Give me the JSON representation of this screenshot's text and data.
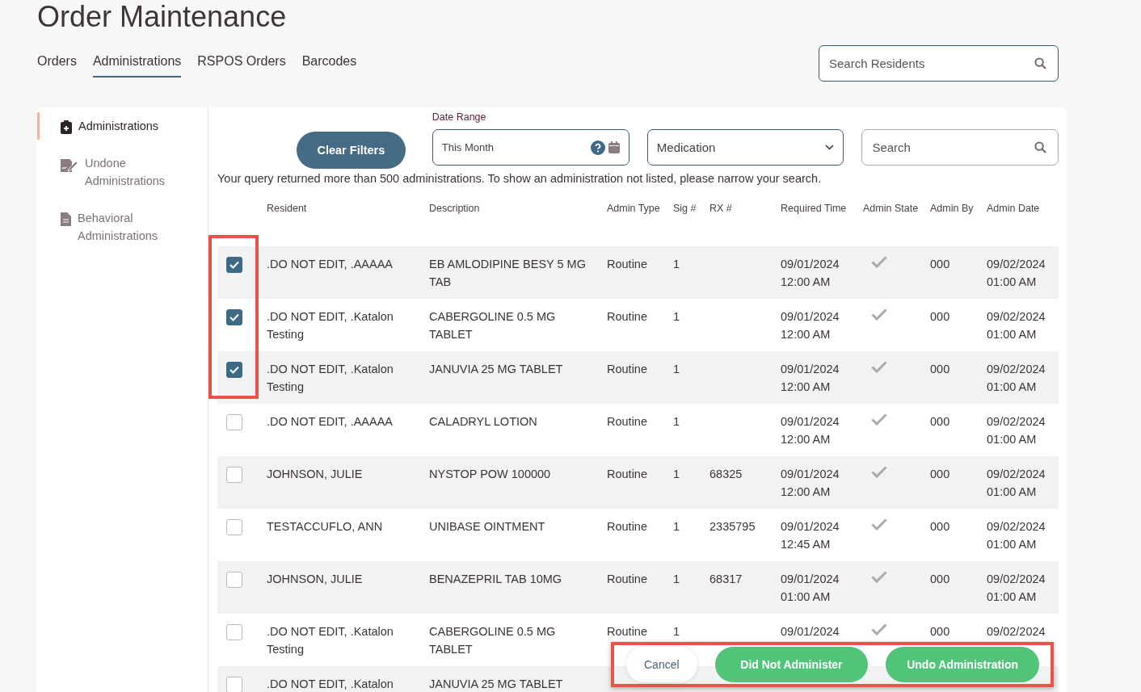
{
  "page_title": "Order Maintenance",
  "tabs": [
    {
      "label": "Orders",
      "selected": false
    },
    {
      "label": "Administrations",
      "selected": true
    },
    {
      "label": "RSPOS Orders",
      "selected": false
    },
    {
      "label": "Barcodes",
      "selected": false
    }
  ],
  "resident_search": {
    "placeholder": "Search Residents"
  },
  "sidebar": {
    "items": [
      {
        "label": "Administrations",
        "selected": true,
        "kind": "clipboard"
      },
      {
        "label": "Undone Administrations",
        "selected": false,
        "kind": "signature"
      },
      {
        "label": "Behavioral Administrations",
        "selected": false,
        "kind": "document"
      }
    ]
  },
  "filters": {
    "clear_button": "Clear Filters",
    "date_range_label": "Date Range",
    "date_range_value": "This Month",
    "medication_select": "Medication",
    "search": {
      "placeholder": "Search"
    }
  },
  "message": "Your query returned more than 500 administrations. To show an administration not listed, please narrow your search.",
  "table": {
    "selection_highlighted": true,
    "columns": [
      "Resident",
      "Description",
      "Admin Type",
      "Sig #",
      "RX #",
      "Required Time",
      "Admin State",
      "Admin By",
      "Admin Date"
    ],
    "rows": [
      {
        "checked": true,
        "resident": ".DO NOT EDIT, .AAAAA",
        "description": "EB AMLODIPINE BESY 5 MG TAB",
        "admin_type": "Routine",
        "sig": "1",
        "rx": "",
        "required_date": "09/01/2024",
        "required_time": "12:00 AM",
        "administered": true,
        "admin_by": "000",
        "admin_date": "09/02/2024",
        "admin_time": "01:00 AM"
      },
      {
        "checked": true,
        "resident": ".DO NOT EDIT, .Katalon Testing",
        "description": "CABERGOLINE 0.5 MG TABLET",
        "admin_type": "Routine",
        "sig": "1",
        "rx": "",
        "required_date": "09/01/2024",
        "required_time": "12:00 AM",
        "administered": true,
        "admin_by": "000",
        "admin_date": "09/02/2024",
        "admin_time": "01:00 AM"
      },
      {
        "checked": true,
        "resident": ".DO NOT EDIT, .Katalon Testing",
        "description": "JANUVIA 25 MG TABLET",
        "admin_type": "Routine",
        "sig": "1",
        "rx": "",
        "required_date": "09/01/2024",
        "required_time": "12:00 AM",
        "administered": true,
        "admin_by": "000",
        "admin_date": "09/02/2024",
        "admin_time": "01:00 AM"
      },
      {
        "checked": false,
        "resident": ".DO NOT EDIT, .AAAAA",
        "description": "CALADRYL LOTION",
        "admin_type": "Routine",
        "sig": "1",
        "rx": "",
        "required_date": "09/01/2024",
        "required_time": "12:00 AM",
        "administered": true,
        "admin_by": "000",
        "admin_date": "09/02/2024",
        "admin_time": "01:00 AM"
      },
      {
        "checked": false,
        "resident": "JOHNSON, JULIE",
        "description": "NYSTOP POW 100000",
        "admin_type": "Routine",
        "sig": "1",
        "rx": "68325",
        "required_date": "09/01/2024",
        "required_time": "12:00 AM",
        "administered": true,
        "admin_by": "000",
        "admin_date": "09/02/2024",
        "admin_time": "01:00 AM"
      },
      {
        "checked": false,
        "resident": "TESTACCUFLO, ANN",
        "description": "UNIBASE OINTMENT",
        "admin_type": "Routine",
        "sig": "1",
        "rx": "2335795",
        "required_date": "09/01/2024",
        "required_time": "12:45 AM",
        "administered": true,
        "admin_by": "000",
        "admin_date": "09/02/2024",
        "admin_time": "01:00 AM"
      },
      {
        "checked": false,
        "resident": "JOHNSON, JULIE",
        "description": "BENAZEPRIL TAB 10MG",
        "admin_type": "Routine",
        "sig": "1",
        "rx": "68317",
        "required_date": "09/01/2024",
        "required_time": "01:00 AM",
        "administered": true,
        "admin_by": "000",
        "admin_date": "09/02/2024",
        "admin_time": "01:00 AM"
      },
      {
        "checked": false,
        "resident": ".DO NOT EDIT, .Katalon Testing",
        "description": "CABERGOLINE 0.5 MG TABLET",
        "admin_type": "Routine",
        "sig": "1",
        "rx": "",
        "required_date": "09/01/2024",
        "required_time": "",
        "administered": true,
        "admin_by": "000",
        "admin_date": "09/02/2024",
        "admin_time": ""
      },
      {
        "checked": false,
        "resident": ".DO NOT EDIT, .Katalon",
        "description": "JANUVIA 25 MG TABLET",
        "admin_type": "",
        "sig": "",
        "rx": "",
        "required_date": "",
        "required_time": "",
        "admin_by": "",
        "admin_date": "",
        "admin_time": ""
      }
    ]
  },
  "action_bar": {
    "highlighted": true,
    "buttons": [
      {
        "label": "Cancel",
        "kind": "plain"
      },
      {
        "label": "Did Not Administer",
        "kind": "primary"
      },
      {
        "label": "Undo Administration",
        "kind": "primary"
      }
    ]
  }
}
